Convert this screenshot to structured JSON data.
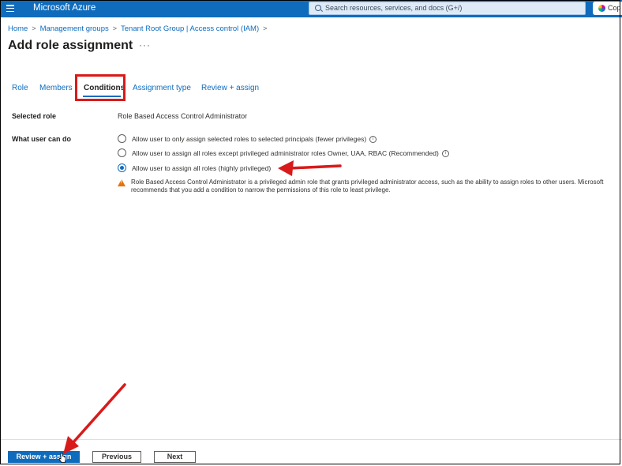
{
  "topbar": {
    "brand": "Microsoft Azure",
    "search_placeholder": "Search resources, services, and docs (G+/)",
    "copilot_label": "Cop"
  },
  "breadcrumb": [
    "Home",
    "Management groups",
    "Tenant Root Group | Access control (IAM)"
  ],
  "page": {
    "title": "Add role assignment",
    "more_label": "···"
  },
  "tabs": [
    {
      "label": "Role"
    },
    {
      "label": "Members"
    },
    {
      "label": "Conditions"
    },
    {
      "label": "Assignment type"
    },
    {
      "label": "Review + assign"
    }
  ],
  "selected_role": {
    "label": "Selected role",
    "value": "Role Based Access Control Administrator"
  },
  "user_can_do": {
    "label": "What user can do",
    "options": [
      {
        "label": "Allow user to only assign selected roles to selected principals (fewer privileges)",
        "selected": false
      },
      {
        "label": "Allow user to assign all roles except privileged administrator roles Owner, UAA, RBAC (Recommended)",
        "selected": false
      },
      {
        "label": "Allow user to assign all roles (highly privileged)",
        "selected": true
      }
    ],
    "warning": "Role Based Access Control Administrator is a privileged admin role that grants privileged administrator access, such as the ability to assign roles to other users. Microsoft recommends that you add a condition to narrow the permissions of this role to least privilege."
  },
  "footer": {
    "review_label": "Review + assign",
    "previous_label": "Previous",
    "next_label": "Next"
  },
  "colors": {
    "azure_blue": "#0f6cbd",
    "annotation_red": "#d91a1a",
    "warning_orange": "#e3730c"
  }
}
